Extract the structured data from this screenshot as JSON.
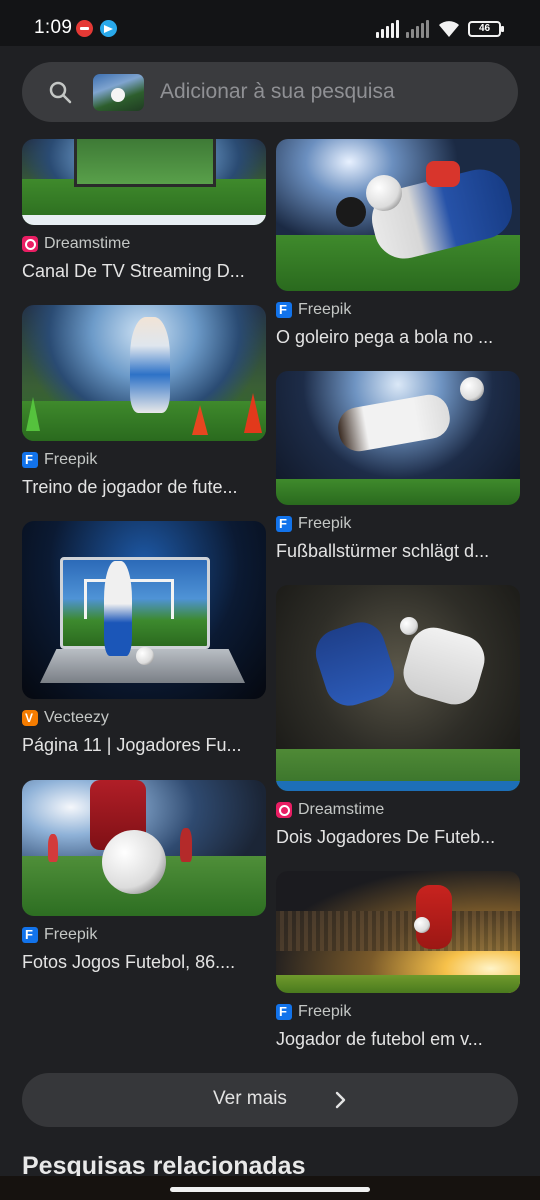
{
  "status_bar": {
    "time": "1:09",
    "battery": "46",
    "icons": [
      "do-not-disturb-icon",
      "telegram-icon",
      "signal-icon",
      "signal-x-icon",
      "wifi-icon",
      "battery-icon"
    ]
  },
  "search": {
    "placeholder": "Adicionar à sua pesquisa"
  },
  "results": {
    "left": [
      {
        "source": "Dreamstime",
        "source_icon": "dreamstime-icon",
        "title": "Canal De TV Streaming D..."
      },
      {
        "source": "Freepik",
        "source_icon": "freepik-icon",
        "title": "Treino de jogador de fute..."
      },
      {
        "source": "Vecteezy",
        "source_icon": "vecteezy-icon",
        "title": "Página 11 | Jogadores Fu..."
      },
      {
        "source": "Freepik",
        "source_icon": "freepik-icon",
        "title": "Fotos Jogos Futebol, 86...."
      }
    ],
    "right": [
      {
        "source": "Freepik",
        "source_icon": "freepik-icon",
        "title": "O goleiro pega a bola no ..."
      },
      {
        "source": "Freepik",
        "source_icon": "freepik-icon",
        "title": "Fußballstürmer schlägt d..."
      },
      {
        "source": "Dreamstime",
        "source_icon": "dreamstime-icon",
        "title": "Dois Jogadores De Futeb..."
      },
      {
        "source": "Freepik",
        "source_icon": "freepik-icon",
        "title": "Jogador de futebol em v..."
      }
    ]
  },
  "more_button": {
    "label": "Ver mais"
  },
  "related_heading": "Pesquisas relacionadas",
  "colors": {
    "background": "#1f2023",
    "search_bar": "#3a3b3e",
    "freepik": "#1273eb",
    "dreamstime": "#e91e63",
    "vecteezy": "#f57c00"
  }
}
